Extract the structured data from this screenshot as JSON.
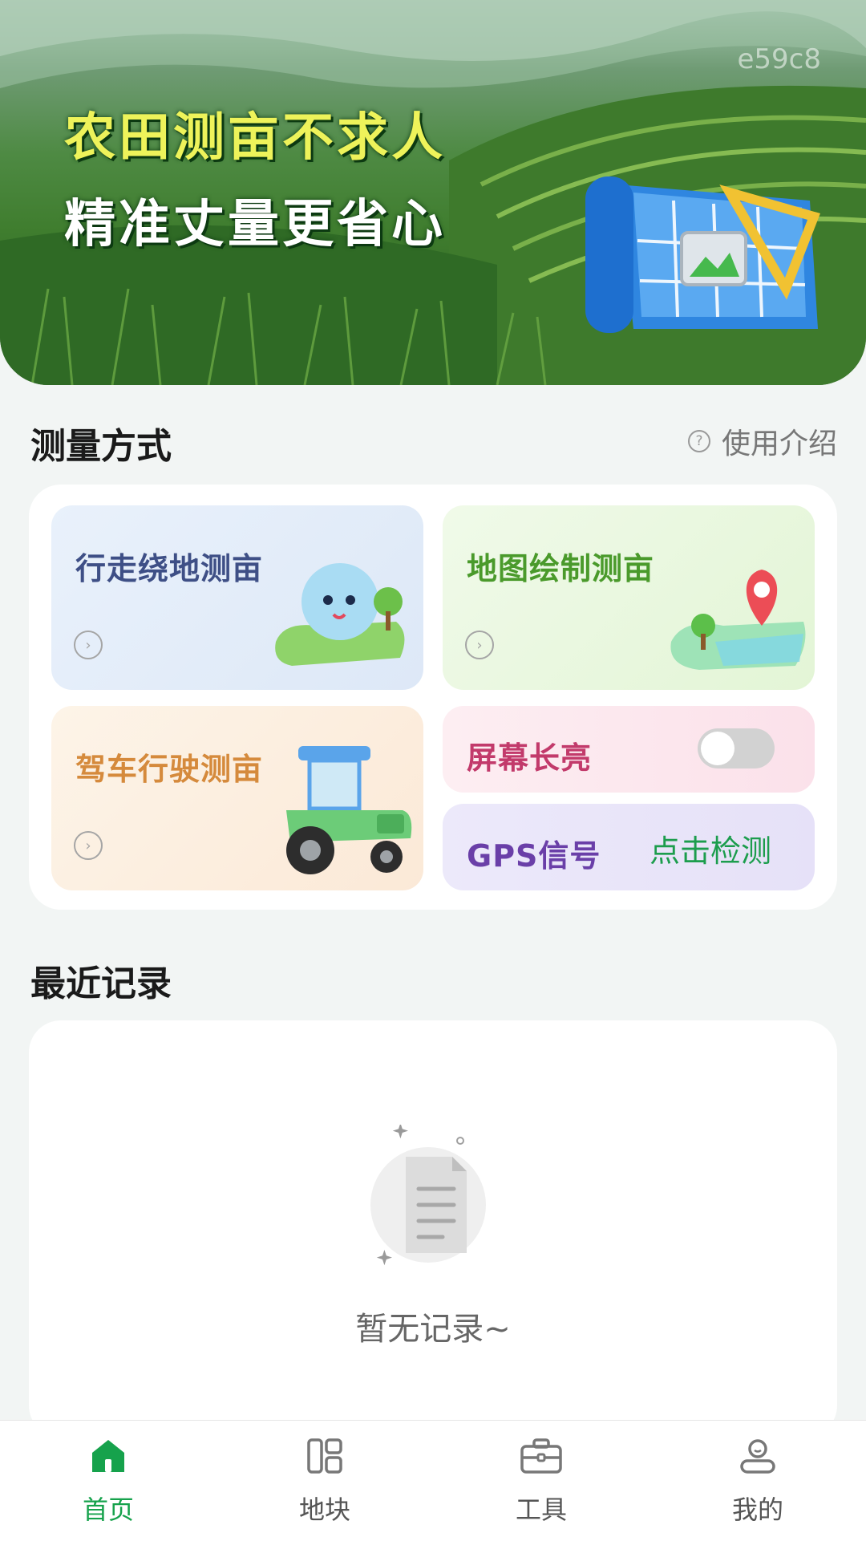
{
  "banner": {
    "code": "e59c8",
    "slogan_line1": "农田测亩不求人",
    "slogan_line2": "精准丈量更省心"
  },
  "methods_section": {
    "title": "测量方式",
    "help_label": "使用介绍",
    "help_icon": "question-circle-icon"
  },
  "methods": {
    "walk": {
      "label": "行走绕地测亩",
      "color": "#3e4f86",
      "icon": "chevron-right-circle-icon"
    },
    "map": {
      "label": "地图绘制测亩",
      "color": "#4a9a2b",
      "icon": "chevron-right-circle-icon"
    },
    "drive": {
      "label": "驾车行驶测亩",
      "color": "#d58a3c",
      "icon": "chevron-right-circle-icon"
    },
    "screen_on": {
      "label": "屏幕长亮",
      "color": "#c23a6b",
      "enabled": false
    },
    "gps": {
      "label": "GPS信号",
      "action": "点击检测",
      "color": "#6a3fa8"
    }
  },
  "records_section": {
    "title": "最近记录",
    "empty_text": "暂无记录~"
  },
  "tabbar": {
    "active_color": "#16a24c",
    "items": [
      {
        "label": "首页",
        "icon": "home-icon",
        "active": true
      },
      {
        "label": "地块",
        "icon": "plots-icon",
        "active": false
      },
      {
        "label": "工具",
        "icon": "toolbox-icon",
        "active": false
      },
      {
        "label": "我的",
        "icon": "profile-icon",
        "active": false
      }
    ]
  }
}
